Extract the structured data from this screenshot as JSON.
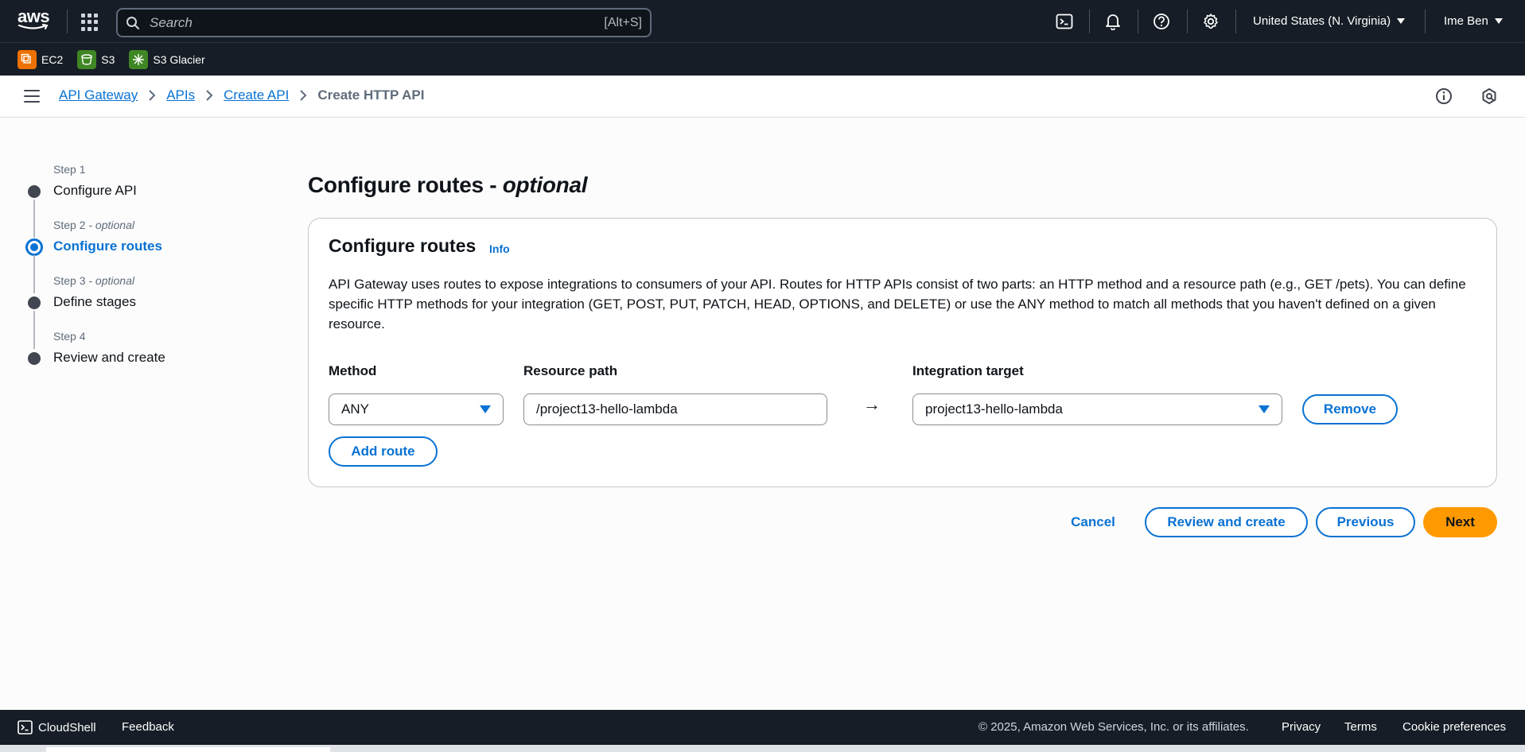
{
  "topnav": {
    "logo_text": "aws",
    "search": {
      "placeholder": "Search",
      "shortcut": "[Alt+S]"
    },
    "region": "United States (N. Virginia)",
    "user": "Ime Ben",
    "icons": [
      "cloudshell-icon",
      "bell-icon",
      "help-icon",
      "gear-icon"
    ]
  },
  "favorites": [
    {
      "label": "EC2",
      "color": "#ed7100"
    },
    {
      "label": "S3",
      "color": "#3f8624"
    },
    {
      "label": "S3 Glacier",
      "color": "#3f8624"
    }
  ],
  "breadcrumb": {
    "items": [
      "API Gateway",
      "APIs",
      "Create API"
    ],
    "current": "Create HTTP API"
  },
  "steps": [
    {
      "num": "Step 1",
      "optional": "",
      "label": "Configure API"
    },
    {
      "num": "Step 2",
      "optional": " - optional",
      "label": "Configure routes"
    },
    {
      "num": "Step 3",
      "optional": " - optional",
      "label": "Define stages"
    },
    {
      "num": "Step 4",
      "optional": "",
      "label": "Review and create"
    }
  ],
  "page": {
    "title": "Configure routes",
    "title_suffix": " - ",
    "title_optional": "optional"
  },
  "card": {
    "title": "Configure routes",
    "info": "Info",
    "description": "API Gateway uses routes to expose integrations to consumers of your API. Routes for HTTP APIs consist of two parts: an HTTP method and a resource path (e.g., GET /pets). You can define specific HTTP methods for your integration (GET, POST, PUT, PATCH, HEAD, OPTIONS, and DELETE) or use the ANY method to match all methods that you haven't defined on a given resource.",
    "method_label": "Method",
    "resource_label": "Resource path",
    "target_label": "Integration target",
    "method_value": "ANY",
    "resource_value": "/project13-hello-lambda",
    "arrow": "→",
    "target_value": "project13-hello-lambda",
    "remove": "Remove",
    "add_route": "Add route"
  },
  "actions": {
    "cancel": "Cancel",
    "review": "Review and create",
    "previous": "Previous",
    "next": "Next"
  },
  "footer": {
    "cloudshell": "CloudShell",
    "feedback": "Feedback",
    "copyright": "© 2025, Amazon Web Services, Inc. or its affiliates.",
    "privacy": "Privacy",
    "terms": "Terms",
    "cookies": "Cookie preferences"
  },
  "colors": {
    "accent": "#0972d3",
    "primary_button": "#ff9900",
    "nav_bg": "#161d26"
  }
}
